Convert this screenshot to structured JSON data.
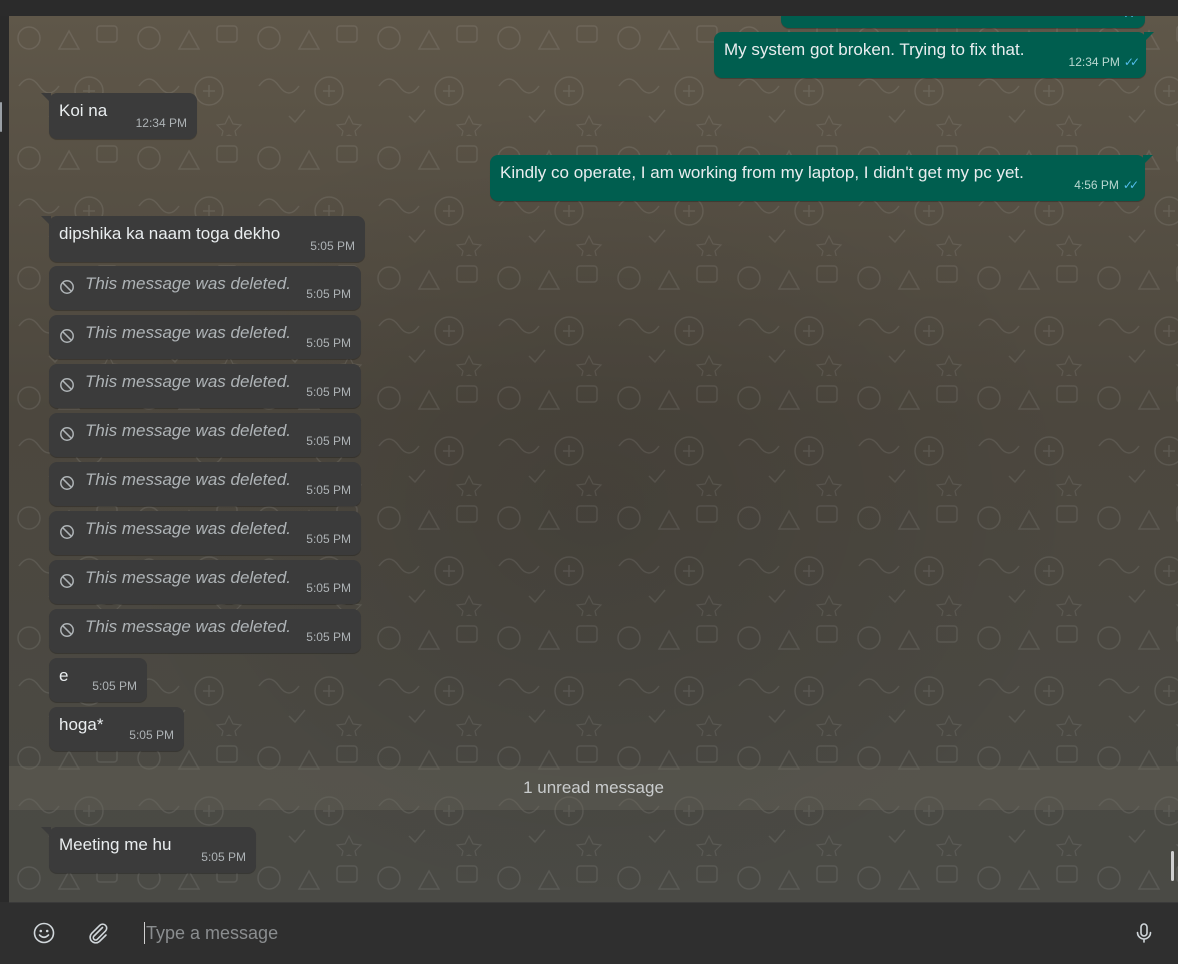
{
  "colors": {
    "incoming_bubble": "#3b3b3b",
    "outgoing_bubble": "#005e4f",
    "read_ticks": "#53bdeb",
    "composer_bg": "#2f2f2f"
  },
  "messages": [
    {
      "direction": "out",
      "text": "My system got broken. Trying to fix that.",
      "time": "12:34 PM",
      "status": "read"
    },
    {
      "direction": "in",
      "text": "Koi na",
      "time": "12:34 PM"
    },
    {
      "direction": "out",
      "text": "Kindly co operate, I am working from my laptop, I didn't get my pc yet.",
      "time": "4:56 PM",
      "status": "read"
    },
    {
      "direction": "in",
      "text": "dipshika ka naam toga dekho",
      "time": "5:05 PM"
    },
    {
      "direction": "in",
      "deleted": true,
      "text": "This message was deleted.",
      "time": "5:05 PM"
    },
    {
      "direction": "in",
      "deleted": true,
      "text": "This message was deleted.",
      "time": "5:05 PM"
    },
    {
      "direction": "in",
      "deleted": true,
      "text": "This message was deleted.",
      "time": "5:05 PM"
    },
    {
      "direction": "in",
      "deleted": true,
      "text": "This message was deleted.",
      "time": "5:05 PM"
    },
    {
      "direction": "in",
      "deleted": true,
      "text": "This message was deleted.",
      "time": "5:05 PM"
    },
    {
      "direction": "in",
      "deleted": true,
      "text": "This message was deleted.",
      "time": "5:05 PM"
    },
    {
      "direction": "in",
      "deleted": true,
      "text": "This message was deleted.",
      "time": "5:05 PM"
    },
    {
      "direction": "in",
      "deleted": true,
      "text": "This message was deleted.",
      "time": "5:05 PM"
    },
    {
      "direction": "in",
      "text": "e",
      "time": "5:05 PM"
    },
    {
      "direction": "in",
      "text": "hoga*",
      "time": "5:05 PM"
    },
    {
      "direction": "in",
      "text": "Meeting me hu",
      "time": "5:05 PM"
    }
  ],
  "unread_divider": "1 unread message",
  "composer": {
    "placeholder": "Type a message",
    "emoji_icon": "emoji-smiley-icon",
    "attach_icon": "paperclip-icon",
    "mic_icon": "microphone-icon"
  }
}
